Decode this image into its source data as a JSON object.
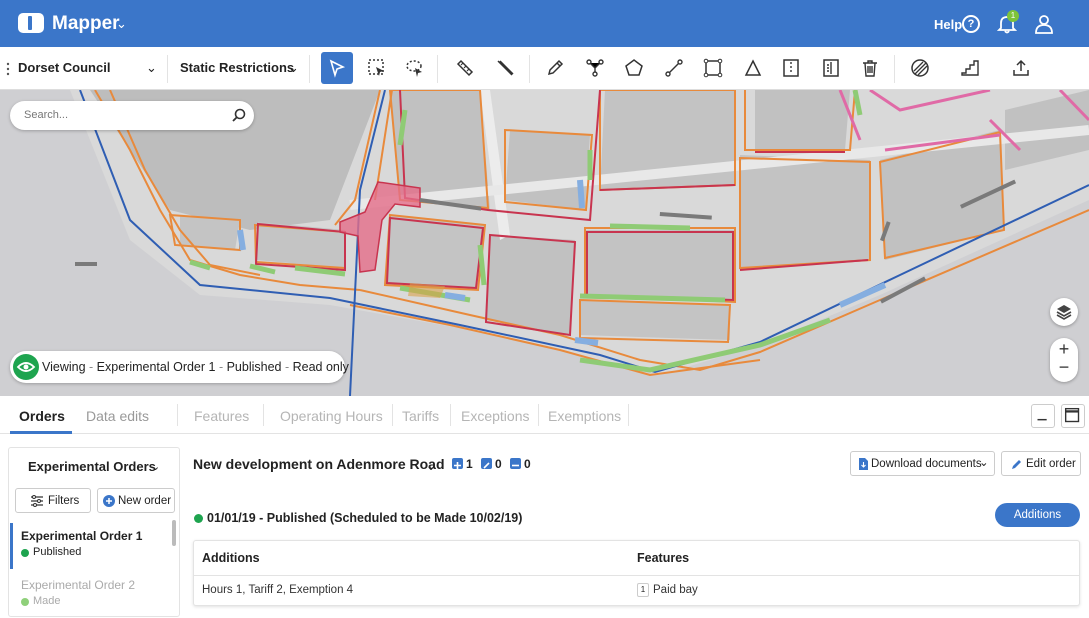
{
  "header": {
    "app_title": "Mapper",
    "help_label": "Help",
    "notification_count": "1"
  },
  "toolbar": {
    "council": "Dorset Council",
    "layer": "Static Restrictions",
    "tools": [
      "select",
      "select-box",
      "select-lasso",
      "ruler",
      "measure-line",
      "pencil",
      "split",
      "polygon",
      "line",
      "rectangle",
      "triangle",
      "split-vertical",
      "split-horizontal",
      "trash",
      "overlay",
      "stairs",
      "upload"
    ]
  },
  "map": {
    "search_placeholder": "Search...",
    "viewing": {
      "mode": "Viewing",
      "sep1": " - ",
      "order": "Experimental Order 1",
      "sep2": " - ",
      "status": "Published",
      "sep3": " - ",
      "access": "Read only"
    }
  },
  "tabs": [
    "Orders",
    "Data edits",
    "Features",
    "Operating Hours",
    "Tariffs",
    "Exceptions",
    "Exemptions"
  ],
  "left_panel": {
    "title": "Experimental Orders",
    "filters_label": "Filters",
    "new_order_label": "New order",
    "orders": [
      {
        "title": "Experimental Order 1",
        "status": "Published",
        "status_color": "#1ea44f"
      },
      {
        "title": "Experimental Order 2",
        "status": "Made",
        "status_color": "#8fd07a"
      }
    ]
  },
  "order": {
    "title": "New development on Adenmore Road",
    "added_count": "1",
    "edited_count": "0",
    "removed_count": "0",
    "download_label": "Download documents",
    "edit_label": "Edit order",
    "published_line": "01/01/19 - Published  (Scheduled to be Made 10/02/19)",
    "additions_pill": "Additions",
    "table": {
      "col1": "Additions",
      "col2": "Features",
      "additions_value": "Hours 1,  Tariff 2,  Exemption 4",
      "feature_count": "1",
      "feature_value": "Paid bay"
    }
  },
  "colors": {
    "brand": "#3b76c9",
    "published": "#1ea44f"
  }
}
